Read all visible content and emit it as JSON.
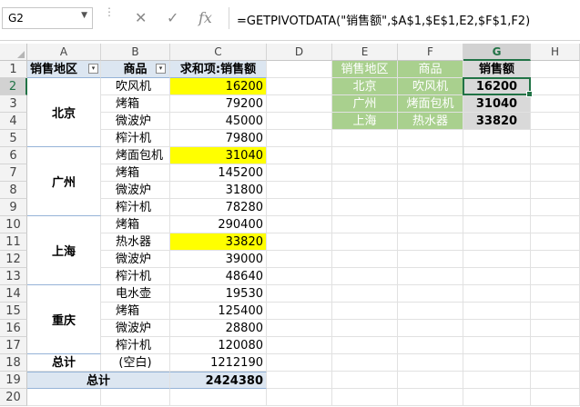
{
  "formula_bar": {
    "name_box": "G2",
    "formula": "=GETPIVOTDATA(\"销售额\",$A$1,$E$1,E2,$F$1,F2)",
    "cancel_icon": "✕",
    "enter_icon": "✓",
    "fx_icon": "fx"
  },
  "columns": [
    "A",
    "B",
    "C",
    "D",
    "E",
    "F",
    "G",
    "H"
  ],
  "rows": [
    "1",
    "2",
    "3",
    "4",
    "5",
    "6",
    "7",
    "8",
    "9",
    "10",
    "11",
    "12",
    "13",
    "14",
    "15",
    "16",
    "17",
    "18",
    "19",
    "20"
  ],
  "pivot": {
    "header_region": "销售地区",
    "header_product": "商品",
    "header_sum": "求和项:销售额",
    "groups": [
      {
        "region": "北京",
        "items": [
          [
            "吹风机",
            "16200"
          ],
          [
            "烤箱",
            "79200"
          ],
          [
            "微波炉",
            "45000"
          ],
          [
            "榨汁机",
            "79800"
          ]
        ]
      },
      {
        "region": "广州",
        "items": [
          [
            "烤面包机",
            "31040"
          ],
          [
            "烤箱",
            "145200"
          ],
          [
            "微波炉",
            "31800"
          ],
          [
            "榨汁机",
            "78280"
          ]
        ]
      },
      {
        "region": "上海",
        "items": [
          [
            "烤箱",
            "290400"
          ],
          [
            "热水器",
            "33820"
          ],
          [
            "微波炉",
            "39000"
          ],
          [
            "榨汁机",
            "48640"
          ]
        ]
      },
      {
        "region": "重庆",
        "items": [
          [
            "电水壶",
            "19530"
          ],
          [
            "烤箱",
            "125400"
          ],
          [
            "微波炉",
            "28800"
          ],
          [
            "榨汁机",
            "120080"
          ]
        ]
      }
    ],
    "row18_a": "总计",
    "row18_b": "(空白)",
    "row18_c": "1212190",
    "grand_label": "总计",
    "grand_value": "2424380",
    "filter_icon": "▾"
  },
  "lookup": {
    "h_region": "销售地区",
    "h_product": "商品",
    "h_sales": "销售额",
    "rows": [
      [
        "北京",
        "吹风机",
        "16200"
      ],
      [
        "广州",
        "烤面包机",
        "31040"
      ],
      [
        "上海",
        "热水器",
        "33820"
      ]
    ]
  }
}
